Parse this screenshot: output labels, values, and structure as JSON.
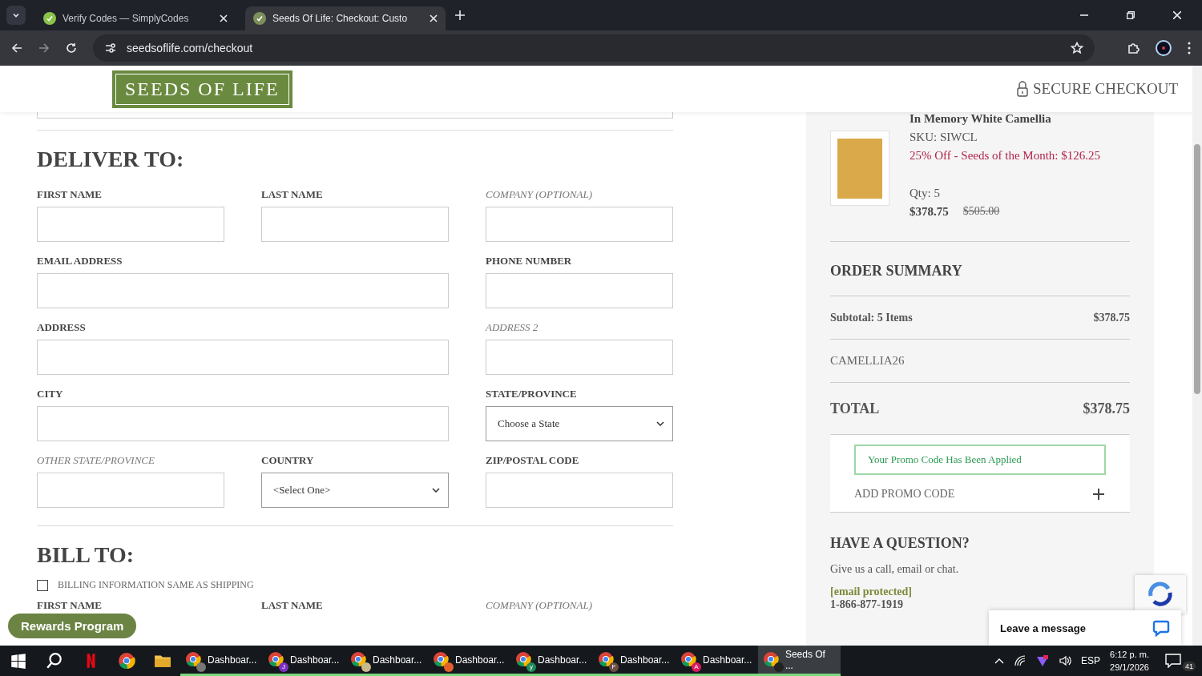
{
  "browser": {
    "tabs": [
      {
        "title": "Verify Codes — SimplyCodes",
        "selected": false,
        "color": "#8bc34a"
      },
      {
        "title": "Seeds Of Life: Checkout: Custo",
        "selected": true,
        "color": "#7d8f5a"
      }
    ],
    "url": "seedsoflife.com/checkout"
  },
  "header": {
    "logo": "SEEDS OF LIFE",
    "secure": "SECURE CHECKOUT"
  },
  "deliver": {
    "heading": "DELIVER TO:",
    "rows": [
      [
        {
          "label": "FIRST NAME",
          "optional": false,
          "kind": "text"
        },
        {
          "label": "LAST NAME",
          "optional": false,
          "kind": "text"
        },
        {
          "label": "COMPANY (OPTIONAL)",
          "optional": true,
          "kind": "text"
        }
      ],
      [
        {
          "label": "EMAIL ADDRESS",
          "optional": false,
          "kind": "text"
        },
        {
          "label": "PHONE NUMBER",
          "optional": false,
          "kind": "text"
        }
      ],
      [
        {
          "label": "ADDRESS",
          "optional": false,
          "kind": "text"
        },
        {
          "label": "ADDRESS 2",
          "optional": true,
          "kind": "text"
        }
      ],
      [
        {
          "label": "CITY",
          "optional": false,
          "kind": "text"
        },
        {
          "label": "STATE/PROVINCE",
          "optional": false,
          "kind": "select",
          "value": "Choose a State"
        }
      ],
      [
        {
          "label": "OTHER STATE/PROVINCE",
          "optional": true,
          "kind": "text"
        },
        {
          "label": "COUNTRY",
          "optional": false,
          "kind": "select",
          "value": "<Select One>"
        },
        {
          "label": "ZIP/POSTAL CODE",
          "optional": false,
          "kind": "text"
        }
      ]
    ]
  },
  "bill": {
    "heading": "BILL TO:",
    "same_as_shipping": {
      "label": "BILLING INFORMATION SAME AS SHIPPING",
      "checked": false
    },
    "labels": [
      {
        "label": "FIRST NAME",
        "optional": false
      },
      {
        "label": "LAST NAME",
        "optional": false
      },
      {
        "label": "COMPANY (OPTIONAL)",
        "optional": true
      }
    ]
  },
  "summary": {
    "product": {
      "name": "In Memory White Camellia",
      "sku": "SKU: SIWCL",
      "discount": "25% Off - Seeds of the Month: $126.25",
      "qty": "Qty: 5",
      "price": "$378.75",
      "old_price": "$505.00"
    },
    "heading": "ORDER SUMMARY",
    "subtotal": {
      "label": "Subtotal: 5 Items",
      "value": "$378.75"
    },
    "promo_code": "CAMELLIA26",
    "total": {
      "label": "TOTAL",
      "value": "$378.75"
    },
    "promo_message": "Your Promo Code Has Been Applied",
    "add_promo": "ADD PROMO CODE",
    "question": {
      "heading": "HAVE A QUESTION?",
      "text": "Give us a call, email or chat.",
      "email": "[email protected]",
      "phone": "1-866-877-1919"
    }
  },
  "rewards": "Rewards Program",
  "chat": "Leave a message",
  "taskbar": {
    "items": [
      {
        "kind": "start"
      },
      {
        "kind": "search"
      },
      {
        "kind": "netflix"
      },
      {
        "kind": "chrome"
      },
      {
        "kind": "folder"
      },
      {
        "kind": "window",
        "label": "Dashboar...",
        "color": "#777777",
        "selected": false
      },
      {
        "kind": "window",
        "label": "Dashboar...",
        "badge": "J",
        "color": "#7b2fbf",
        "selected": false
      },
      {
        "kind": "window",
        "label": "Dashboar...",
        "color": "#c9b98a",
        "selected": false
      },
      {
        "kind": "window",
        "label": "Dashboar...",
        "color": "#e0622a",
        "selected": false
      },
      {
        "kind": "window",
        "label": "Dashboar...",
        "badge": "y",
        "color": "#1f8a5a",
        "selected": false
      },
      {
        "kind": "window",
        "label": "Dashboar...",
        "badge": "F",
        "color": "#6d4c41",
        "selected": false
      },
      {
        "kind": "window",
        "label": "Dashboar...",
        "badge": "A",
        "color": "#d81b60",
        "selected": false
      },
      {
        "kind": "window",
        "label": "Seeds Of ...",
        "color": "#222222",
        "selected": true
      }
    ],
    "language": "ESP",
    "time": "6:12 p. m.",
    "date": "29/1/2026",
    "notifications": "41"
  }
}
